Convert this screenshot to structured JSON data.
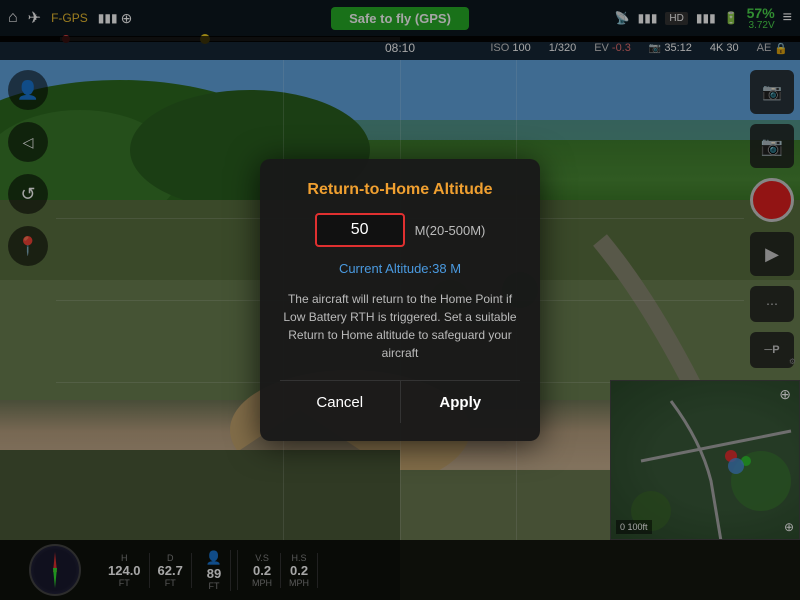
{
  "topbar": {
    "home_icon": "⌂",
    "drone_icon": "✈",
    "aircraft_name": "F-GPS",
    "signal_icon": "📶",
    "gps_icon": "⊕",
    "safe_to_fly": "Safe to fly (GPS)",
    "remote_icon": "📡",
    "signal2_icon": "▮▮▮",
    "hd_label": "HD",
    "signal3_icon": "▮▮▮",
    "battery_icon": "🔋",
    "battery_pct": "57%",
    "battery_volt": "3.72V",
    "menu_icon": "≡"
  },
  "statusbar": {
    "time": "08:10",
    "iso_label": "ISO",
    "iso_value": "100",
    "shutter": "1/320",
    "ev_label": "EV",
    "ev_value": "-0.3",
    "frames_label": "35:12",
    "res_label": "4K 30",
    "ae_label": "AE",
    "lock_icon": "🔒"
  },
  "sidebar_left": {
    "items": [
      {
        "icon": "👤",
        "name": "profile-icon"
      },
      {
        "icon": "◁",
        "name": "back-icon"
      },
      {
        "icon": "↺",
        "name": "rotate-icon"
      },
      {
        "icon": "📍",
        "name": "pin-icon"
      }
    ]
  },
  "sidebar_right": {
    "items": [
      {
        "icon": "📷",
        "name": "camera-settings-icon"
      },
      {
        "icon": "📷",
        "name": "photo-icon"
      },
      {
        "icon": "⏺",
        "name": "record-icon"
      },
      {
        "icon": "▶",
        "name": "playback-icon"
      },
      {
        "icon": "⋯",
        "name": "more-icon"
      },
      {
        "icon": "P",
        "name": "p-mode-icon"
      }
    ]
  },
  "modal": {
    "title": "Return-to-Home Altitude",
    "input_value": "50",
    "unit_hint": "M(20-500M)",
    "current_altitude_label": "Current Altitude:",
    "current_altitude_value": "38 M",
    "description": "The aircraft will return to the Home Point if Low Battery RTH is triggered. Set a suitable Return to Home altitude to safeguard your aircraft",
    "cancel_label": "Cancel",
    "apply_label": "Apply"
  },
  "telemetry": {
    "h_label": "H",
    "h_value": "124.0",
    "h_unit": "FT",
    "d_label": "D",
    "d_value": "62.7",
    "d_unit": "FT",
    "person_icon": "👤",
    "person_value": "89",
    "person_unit": "FT",
    "vs_label": "V.S",
    "vs_value": "0.2",
    "vs_unit": "MPH",
    "hs_label": "H.S",
    "hs_value": "0.2",
    "hs_unit": "MPH"
  },
  "colors": {
    "accent_orange": "#f0a030",
    "accent_blue": "#4a9ae0",
    "safe_green": "#27ae27",
    "battery_green": "#4cd94c",
    "record_red": "#e02020",
    "input_border_red": "#e03030"
  }
}
